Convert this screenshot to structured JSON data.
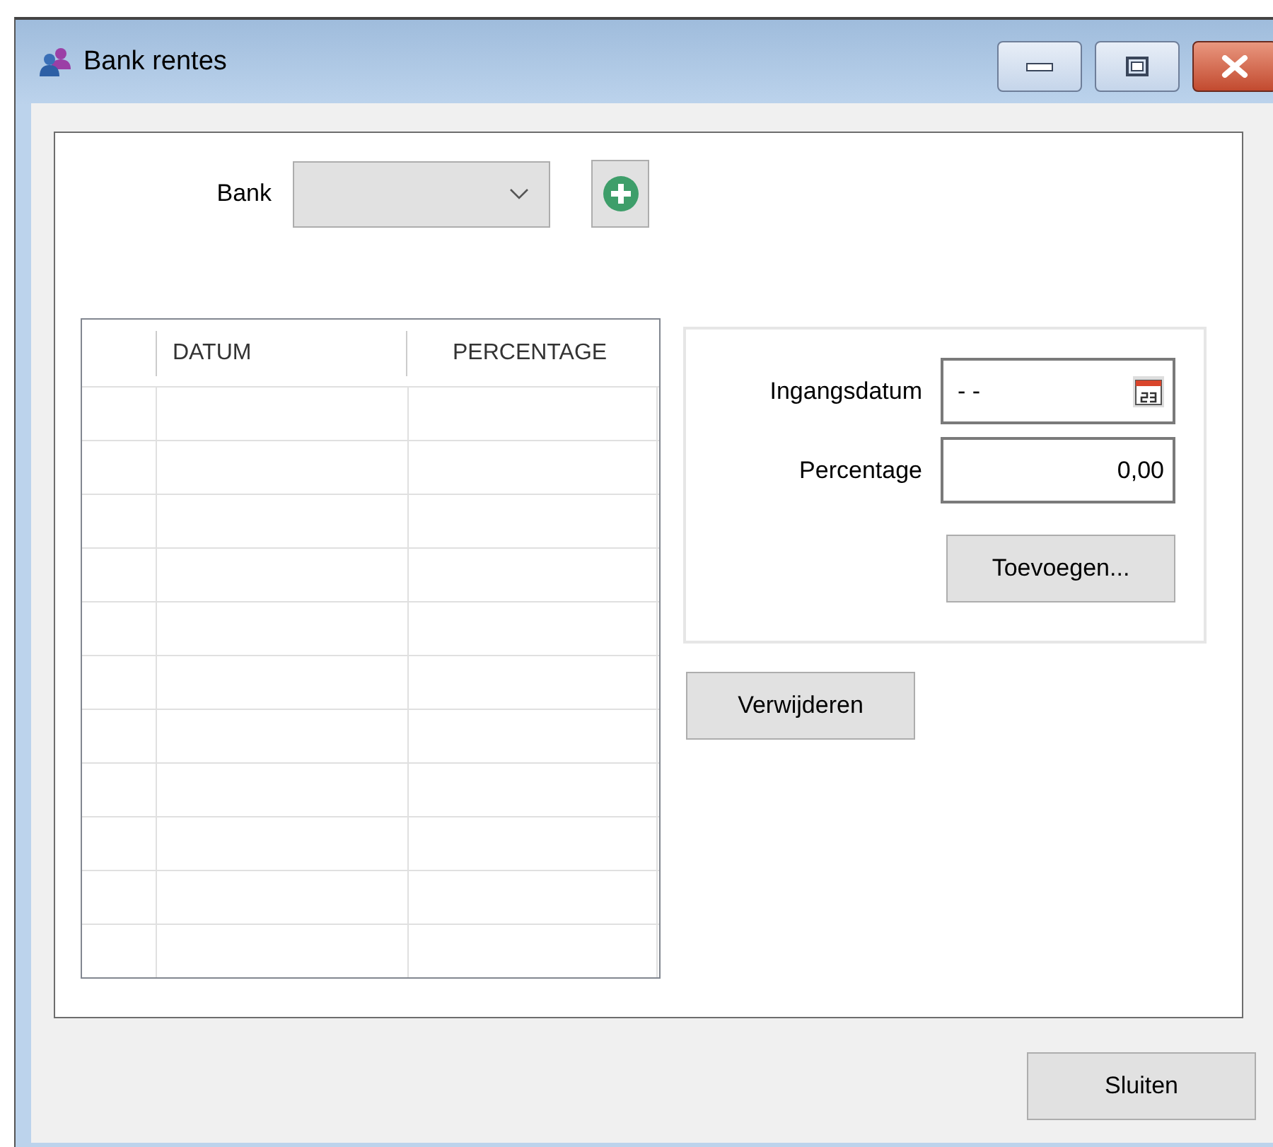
{
  "window": {
    "title": "Bank rentes"
  },
  "bank": {
    "label": "Bank"
  },
  "table": {
    "columns": [
      "DATUM",
      "PERCENTAGE"
    ]
  },
  "form": {
    "fields": [
      {
        "label": "Ingangsdatum",
        "value": "- -",
        "kind": "date"
      },
      {
        "label": "Percentage",
        "value": "0,00",
        "kind": "number"
      }
    ],
    "button": "Toevoegen..."
  },
  "delete_button": "Verwijderen",
  "close_button": "Sluiten"
}
